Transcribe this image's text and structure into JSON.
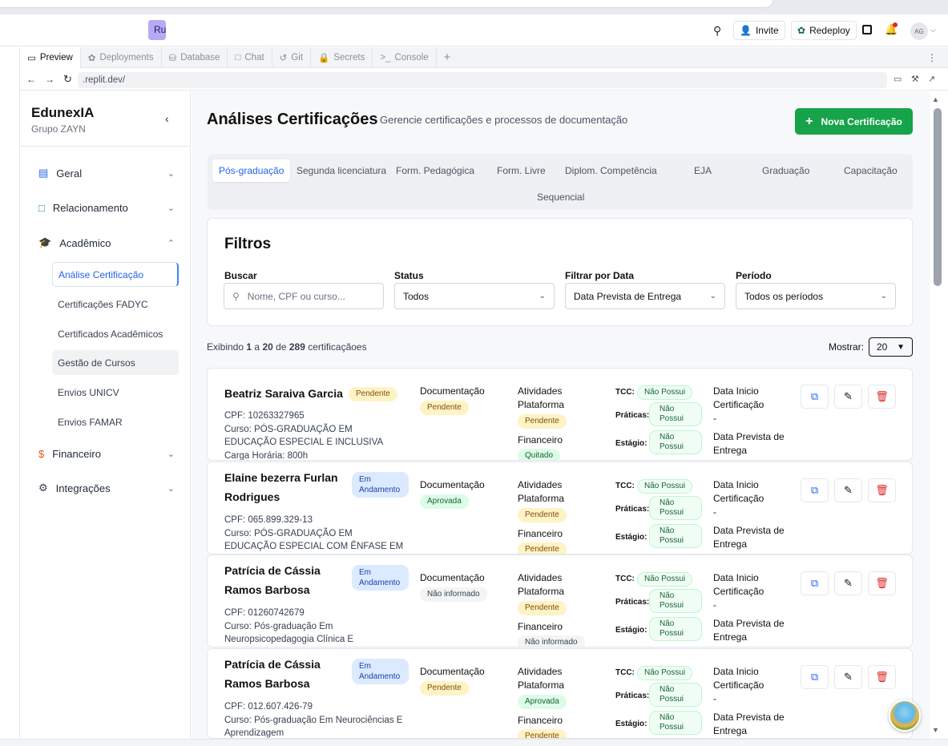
{
  "appbar": {
    "status": "Running",
    "invite": "Invite",
    "redeploy": "Redeploy",
    "avatar": "AG"
  },
  "tabs": [
    "Preview",
    "Deployments",
    "Database",
    "Chat",
    "Git",
    "Secrets",
    "Console"
  ],
  "url": ".replit.dev/",
  "sidebar": {
    "brand": "EdunexIA",
    "subtitle": "Grupo ZAYN",
    "items": [
      "Geral",
      "Relacionamento",
      "Acadêmico",
      "Financeiro",
      "Integrações"
    ],
    "academic_subitems": [
      "Análise Certificação",
      "Certificações FADYC",
      "Certificados Acadêmicos",
      "Gestão de Cursos",
      "Envios UNICV",
      "Envios FAMAR"
    ]
  },
  "page": {
    "title": "Análises Certificações",
    "subtitle": "Gerencie certificações e processos de documentação",
    "new_button": "Nova Certificação"
  },
  "categories": [
    "Pós-graduação",
    "Segunda licenciatura",
    "Form. Pedagógica",
    "Form. Livre",
    "Diplom. Competência",
    "EJA",
    "Graduação",
    "Capacitação",
    "Sequencial"
  ],
  "filters": {
    "title": "Filtros",
    "search_label": "Buscar",
    "search_placeholder": "Nome, CPF ou curso...",
    "status_label": "Status",
    "status_value": "Todos",
    "date_label": "Filtrar por Data",
    "date_value": "Data Prevista de Entrega",
    "period_label": "Período",
    "period_value": "Todos os períodos"
  },
  "summary": {
    "prefix": "Exibindo",
    "from": "1",
    "a": "a",
    "to": "20",
    "de": "de",
    "total": "289",
    "suffix": "certificaçãoes",
    "show_label": "Mostrar:",
    "show_value": "20"
  },
  "card_labels": {
    "documentacao": "Documentação",
    "atividades": "Atividades Plataforma",
    "financeiro": "Financeiro",
    "tcc": "TCC:",
    "praticas": "Práticas:",
    "estagio": "Estágio:",
    "data_inicio": "Data Inicio Certificação",
    "data_prevista": "Data Prevista de Entrega",
    "nao_possui": "Não Possui",
    "dash": "-"
  },
  "records": [
    {
      "name": "Beatriz Saraiva Garcia",
      "status": "Pendente",
      "cpf": "CPF: 10263327965",
      "curso": "Curso: PÓS-GRADUAÇÃO EM EDUCAÇÃO ESPECIAL E INCLUSIVA",
      "carga": "Carga Horária: 800h",
      "doc": "Pendente",
      "ativ": "Pendente",
      "fin": "Quitado"
    },
    {
      "name": "Elaine bezerra Furlan Rodrigues",
      "status": "Em Andamento",
      "cpf": "CPF: 065.899.329-13",
      "curso": "Curso: PÓS-GRADUAÇÃO EM EDUCAÇÃO ESPECIAL COM ÊNFASE EM TGD E ALTAS",
      "carga": "",
      "doc": "Aprovada",
      "ativ": "Pendente",
      "fin": "Pendente"
    },
    {
      "name": "Patrícia de Cássia Ramos Barbosa",
      "status": "Em Andamento",
      "cpf": "CPF: 01260742679",
      "curso": "Curso: Pós-graduação Em Neuropsicopedagogia Clínica E Institucional",
      "carga": "",
      "doc": "Não informado",
      "ativ": "Pendente",
      "fin": "Não informado"
    },
    {
      "name": "Patrícia de Cássia Ramos Barbosa",
      "status": "Em Andamento",
      "cpf": "CPF: 012.607.426-79",
      "curso": "Curso: Pós-graduação Em Neurociências E Aprendizagem",
      "carga": "",
      "doc": "Pendente",
      "ativ": "Aprovada",
      "fin": "Pendente"
    }
  ]
}
